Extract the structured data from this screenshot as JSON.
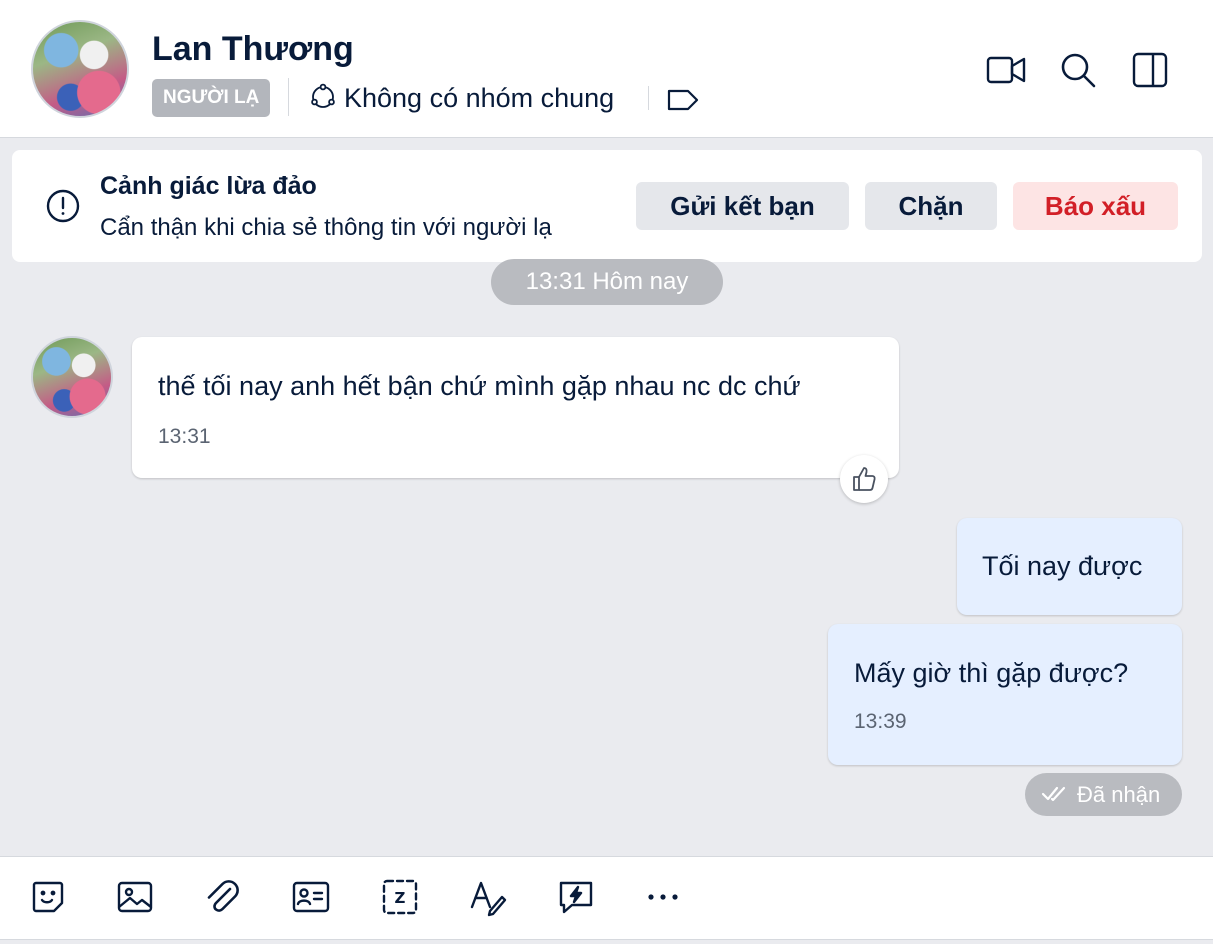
{
  "header": {
    "name": "Lan Thương",
    "badge": "NGƯỜI LẠ",
    "group_status": "Không có nhóm chung",
    "icons": [
      "video-call-icon",
      "search-icon",
      "side-panel-icon",
      "tag-icon",
      "group-icon"
    ]
  },
  "warning": {
    "title": "Cảnh giác lừa đảo",
    "description": "Cẩn thận khi chia sẻ thông tin với người lạ",
    "add_friend": "Gửi kết bạn",
    "block": "Chặn",
    "report": "Báo xấu"
  },
  "conversation": {
    "divider": "13:31 Hôm nay",
    "messages": [
      {
        "direction": "in",
        "text": "thế tối nay anh hết bận chứ mình gặp nhau nc dc chứ",
        "time": "13:31"
      },
      {
        "direction": "out",
        "text": "Tối nay được",
        "time": ""
      },
      {
        "direction": "out",
        "text": "Mấy giờ thì gặp được?",
        "time": "13:39"
      }
    ],
    "status": "Đã nhận"
  },
  "toolbar": {
    "icons": [
      "sticker-icon",
      "image-icon",
      "attach-icon",
      "contact-card-icon",
      "screenshot-icon",
      "format-text-icon",
      "quick-message-icon",
      "more-icon"
    ]
  },
  "colors": {
    "text": "#081b3a",
    "background": "#eaebef",
    "outgoing_bubble": "#e5efff",
    "report_text": "#d21f27",
    "report_bg": "#fde4e4"
  }
}
